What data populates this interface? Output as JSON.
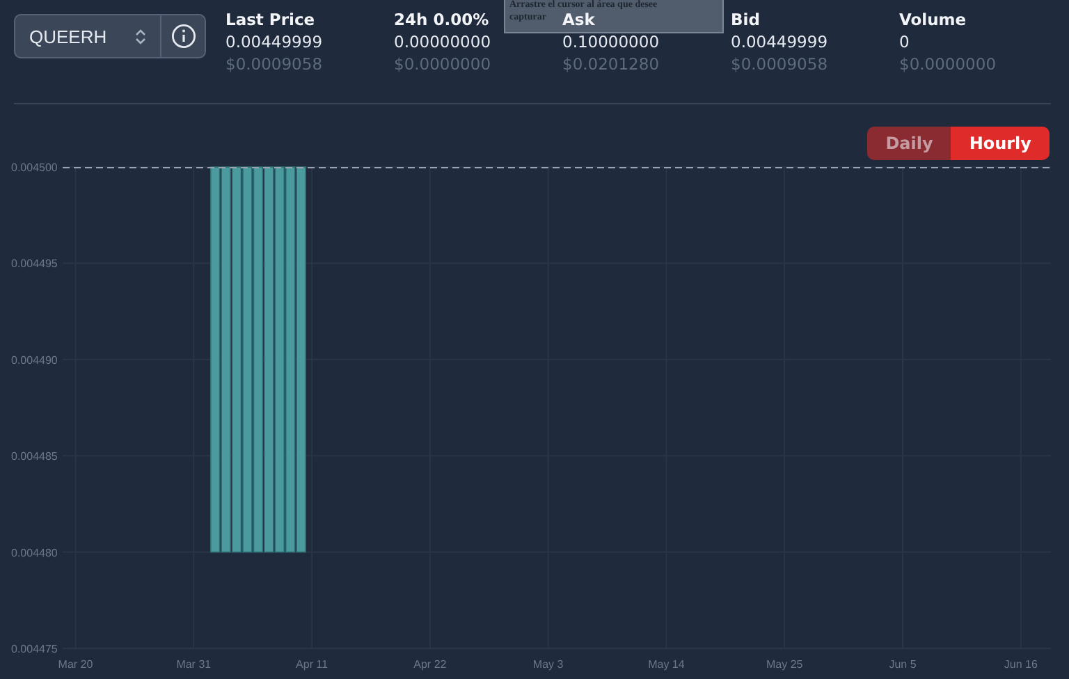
{
  "symbol_selector": {
    "value": "QUEERH"
  },
  "stats": [
    {
      "label": "Last Price",
      "value": "0.00449999",
      "usd": "$0.0009058"
    },
    {
      "label": "24h 0.00%",
      "value": "0.00000000",
      "usd": "$0.0000000"
    },
    {
      "label": "Ask",
      "value": "0.10000000",
      "usd": "$0.0201280"
    },
    {
      "label": "Bid",
      "value": "0.00449999",
      "usd": "$0.0009058"
    },
    {
      "label": "Volume",
      "value": "0",
      "usd": "$0.0000000"
    }
  ],
  "capture_tooltip": {
    "lines": [
      "Arrastre el cursor al área que desee",
      "capturar"
    ]
  },
  "interval_tabs": [
    {
      "label": "Daily",
      "selected": false
    },
    {
      "label": "Hourly",
      "selected": true
    }
  ],
  "chart": {
    "y_axis_labels": [
      "0.004500",
      "0.004495",
      "0.004490",
      "0.004485",
      "0.004480",
      "0.004475"
    ],
    "x_axis_labels": [
      "Mar 20",
      "Mar 31",
      "Apr 11",
      "Apr 22",
      "May 3",
      "May 14",
      "May 25",
      "Jun 5",
      "Jun 16"
    ]
  }
}
